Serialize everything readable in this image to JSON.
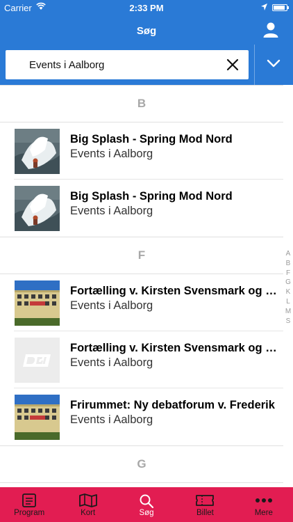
{
  "status_bar": {
    "carrier": "Carrier",
    "time": "2:33 PM",
    "battery_level": 0.9
  },
  "nav": {
    "title": "Søg"
  },
  "search": {
    "value": "Events i Aalborg"
  },
  "sections": [
    {
      "letter": "B",
      "items": [
        {
          "title": "Big Splash - Spring Mod Nord",
          "subtitle": "Events i Aalborg",
          "image": "splash"
        },
        {
          "title": "Big Splash - Spring Mod Nord",
          "subtitle": "Events i Aalborg",
          "image": "splash"
        }
      ]
    },
    {
      "letter": "F",
      "items": [
        {
          "title": "Fortælling v. Kirsten Svensmark og Kim Mathiasen",
          "subtitle": "Events i Aalborg",
          "image": "building"
        },
        {
          "title": "Fortælling v. Kirsten Svensmark og Kim Mathiasen",
          "subtitle": "Events i Aalborg",
          "image": "dgi-logo"
        },
        {
          "title": "Frirummet: Ny debatforum v. Frederik",
          "subtitle": "Events i Aalborg",
          "image": "building"
        }
      ]
    },
    {
      "letter": "G",
      "items": []
    }
  ],
  "index_letters": [
    "A",
    "B",
    "F",
    "G",
    "K",
    "L",
    "M",
    "S"
  ],
  "tabs": [
    {
      "label": "Program",
      "icon": "program-icon"
    },
    {
      "label": "Kort",
      "icon": "map-icon"
    },
    {
      "label": "Søg",
      "icon": "search-icon",
      "active": true
    },
    {
      "label": "Billet",
      "icon": "ticket-icon"
    },
    {
      "label": "Mere",
      "icon": "more-icon"
    }
  ],
  "colors": {
    "primary": "#2a7ad6",
    "tabbar": "#e21d52",
    "tab_active": "#ffffff",
    "tab_inactive": "#1a1a1a"
  }
}
